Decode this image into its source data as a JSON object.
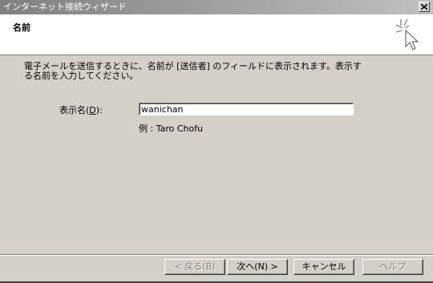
{
  "window": {
    "title": "インターネット接続ウィザード",
    "close_glyph": "×"
  },
  "header": {
    "section_title": "名前",
    "icon": "wizard-cursor-icon"
  },
  "main": {
    "instruction": "電子メールを送信するときに、名前が [送信者] のフィールドに表示されます。表示する名前を入力してください。",
    "field_label_prefix": "表示名(",
    "field_label_accel": "D",
    "field_label_suffix": "):",
    "display_name_value": "wanichan",
    "example": "例 : Taro Chofu"
  },
  "buttons": {
    "back": "< 戻る(B)",
    "next": "次へ(N) >",
    "cancel": "キャンセル",
    "help": "ヘルプ"
  },
  "colors": {
    "face": "#d4d0c8",
    "titlebar_inactive": "#808080"
  }
}
